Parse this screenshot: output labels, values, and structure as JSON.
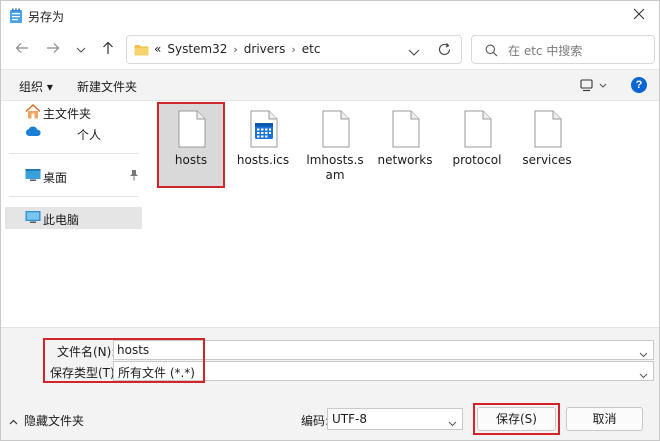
{
  "window": {
    "title": "另存为"
  },
  "nav": {
    "back_icon": "arrow-left-icon",
    "forward_icon": "arrow-right-icon",
    "up_icon": "arrow-up-icon"
  },
  "address": {
    "overflow": "«",
    "crumbs": [
      "System32",
      "drivers",
      "etc"
    ]
  },
  "search": {
    "placeholder": "在 etc 中搜索"
  },
  "toolbar": {
    "organize": "组织 ▾",
    "new_folder": "新建文件夹"
  },
  "sidebar": {
    "items": [
      {
        "label": "主文件夹",
        "icon": "home-icon"
      },
      {
        "label": "个人",
        "icon": "cloud-icon"
      },
      {
        "label": "桌面",
        "icon": "desktop-icon"
      },
      {
        "label": "此电脑",
        "icon": "computer-icon"
      }
    ]
  },
  "files": [
    {
      "name": "hosts",
      "icon": "file-icon",
      "selected": true
    },
    {
      "name": "hosts.ics",
      "icon": "calendar-file-icon",
      "selected": false
    },
    {
      "name": "lmhosts.sam",
      "icon": "file-icon",
      "selected": false
    },
    {
      "name": "networks",
      "icon": "file-icon",
      "selected": false
    },
    {
      "name": "protocol",
      "icon": "file-icon",
      "selected": false
    },
    {
      "name": "services",
      "icon": "file-icon",
      "selected": false
    }
  ],
  "form": {
    "filename_label": "文件名(N):",
    "filename_value": "hosts",
    "filetype_label": "保存类型(T):",
    "filetype_value": "所有文件  (*.*)",
    "hide_folders": "隐藏文件夹",
    "encoding_label": "编码:",
    "encoding_value": "UTF-8",
    "save": "保存(S)",
    "cancel": "取消"
  },
  "colors": {
    "accent": "#0b66d4",
    "highlight": "#d0262b",
    "selection": "#d9d9d9",
    "folder": "#f2c14e"
  }
}
